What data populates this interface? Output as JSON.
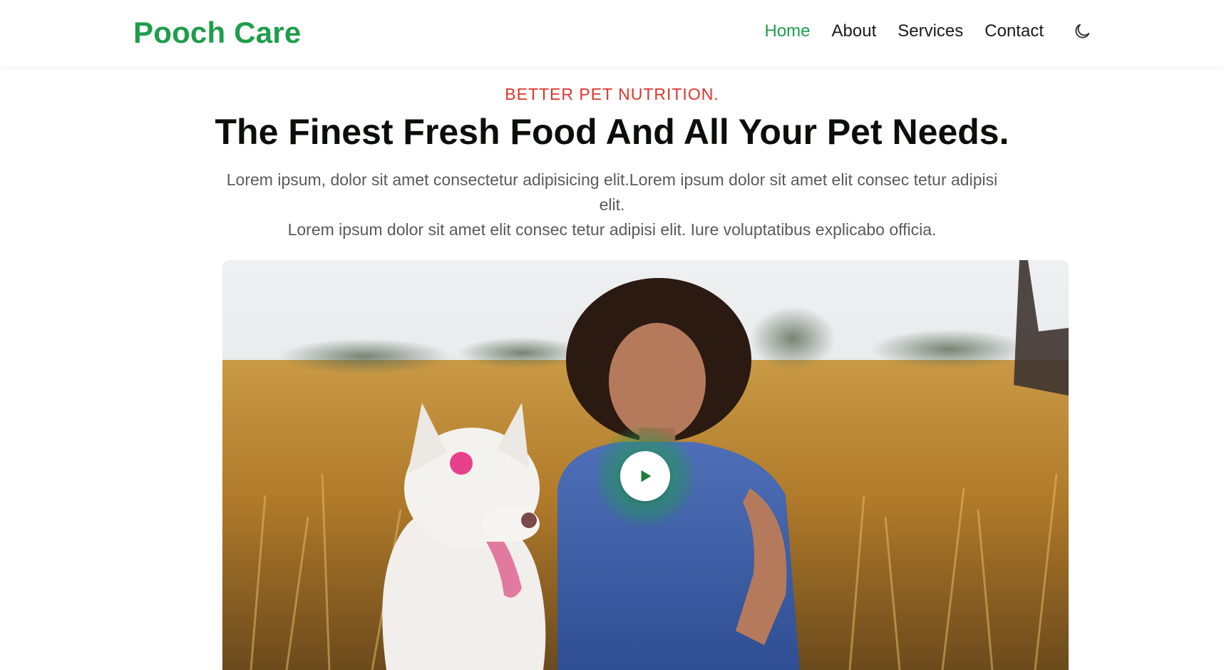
{
  "header": {
    "brand": "Pooch Care",
    "nav": [
      {
        "label": "Home",
        "active": true
      },
      {
        "label": "About",
        "active": false
      },
      {
        "label": "Services",
        "active": false
      },
      {
        "label": "Contact",
        "active": false
      }
    ],
    "theme_icon": "moon-icon"
  },
  "hero": {
    "eyebrow": "BETTER PET NUTRITION.",
    "title": "The Finest Fresh Food And All Your Pet Needs.",
    "description_line1": "Lorem ipsum, dolor sit amet consectetur adipisicing elit.Lorem ipsum dolor sit amet elit consec tetur adipisi elit.",
    "description_line2": "Lorem ipsum dolor sit amet elit consec tetur adipisi elit. Iure voluptatibus explicabo officia.",
    "media_icon": "play-icon"
  },
  "colors": {
    "brand": "#1f9d4b",
    "accent_red": "#e0342c",
    "text_dark": "#0b0f0c",
    "text_muted": "#5a5a5a"
  }
}
